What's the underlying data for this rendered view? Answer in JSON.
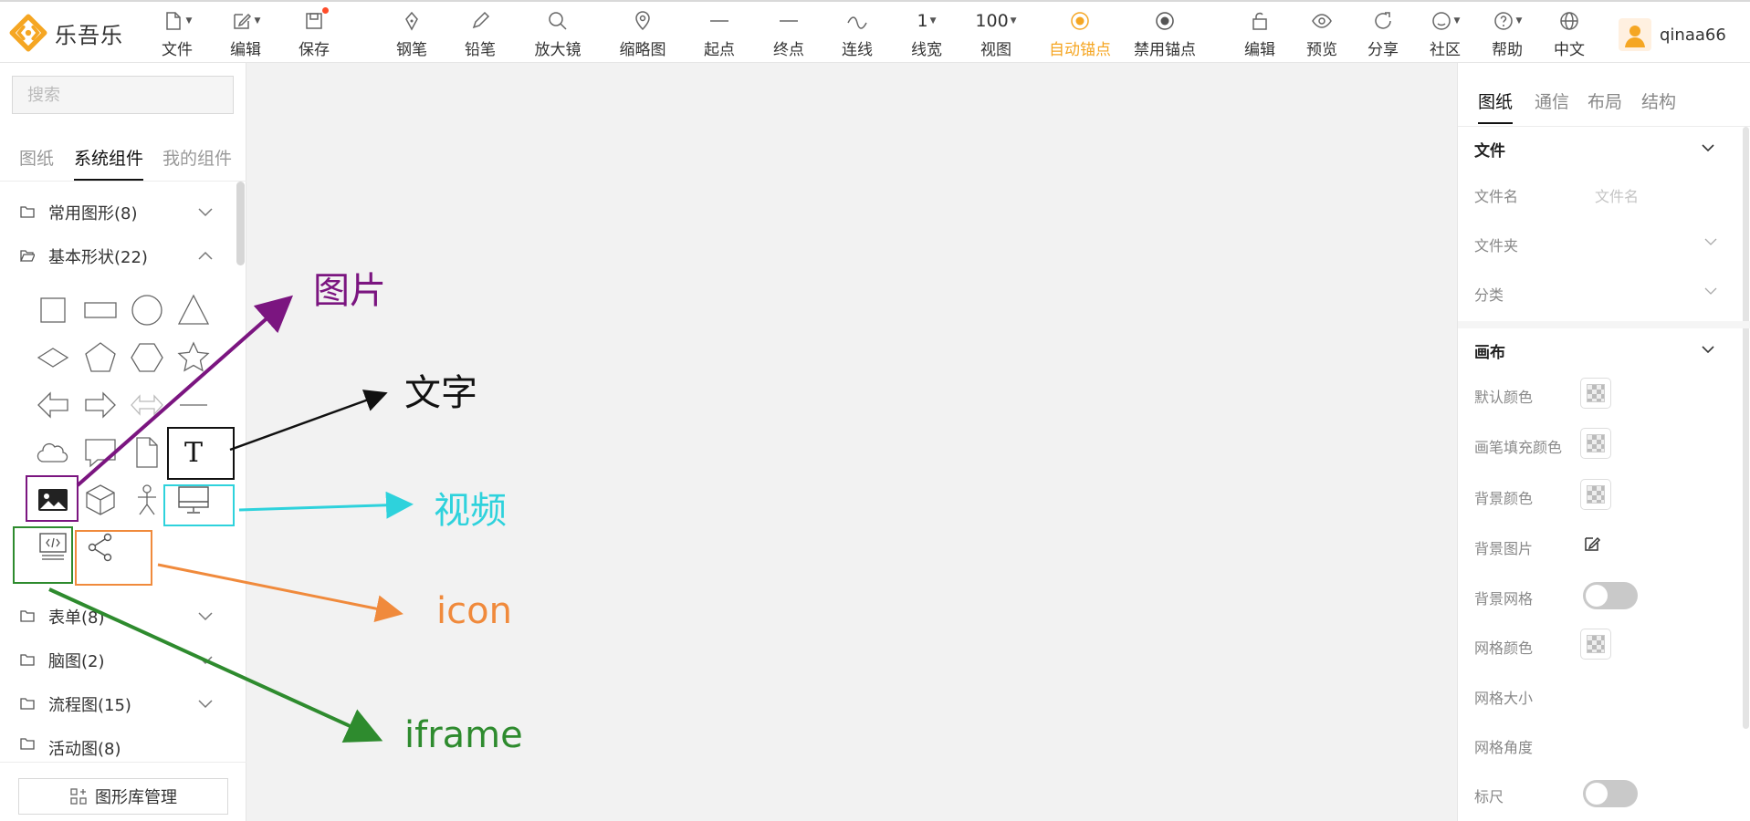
{
  "app": {
    "logo_text": "乐吾乐"
  },
  "toolbar": {
    "file": "文件",
    "edit": "编辑",
    "save": "保存",
    "pen": "钢笔",
    "pencil": "铅笔",
    "magnifier": "放大镜",
    "thumbnail": "缩略图",
    "start": "起点",
    "end": "终点",
    "connector": "连线",
    "line_width_value": "1",
    "line_width": "线宽",
    "view_value": "100",
    "view": "视图",
    "auto_anchor": "自动锚点",
    "disable_anchor": "禁用锚点",
    "edit2": "编辑",
    "preview": "预览",
    "share": "分享",
    "community": "社区",
    "help": "帮助",
    "language": "中文"
  },
  "user": {
    "name": "qinaa66"
  },
  "left": {
    "search_placeholder": "搜索",
    "tabs": [
      "图纸",
      "系统组件",
      "我的组件"
    ],
    "categories": [
      "常用图形(8)",
      "基本形状(22)",
      "表单(8)",
      "脑图(2)",
      "流程图(15)",
      "活动图(8)"
    ],
    "library_button": "图形库管理"
  },
  "annotations": {
    "image": "图片",
    "text": "文字",
    "video": "视频",
    "icon": "icon",
    "iframe": "iframe"
  },
  "right": {
    "tabs": [
      "图纸",
      "通信",
      "布局",
      "结构"
    ],
    "section_file": "文件",
    "file_name_label": "文件名",
    "file_name_placeholder": "文件名",
    "folder_label": "文件夹",
    "category_label": "分类",
    "section_canvas": "画布",
    "default_color": "默认颜色",
    "pen_fill_color": "画笔填充颜色",
    "bg_color": "背景颜色",
    "bg_image": "背景图片",
    "bg_grid": "背景网格",
    "grid_color": "网格颜色",
    "grid_size": "网格大小",
    "grid_angle": "网格角度",
    "ruler": "标尺"
  },
  "colors": {
    "accent": "#f5a623",
    "annotation_purple": "#7b1580",
    "annotation_black": "#111111",
    "annotation_cyan": "#2ed2dc",
    "annotation_orange": "#f08a3c",
    "annotation_green": "#2e8b2e"
  }
}
